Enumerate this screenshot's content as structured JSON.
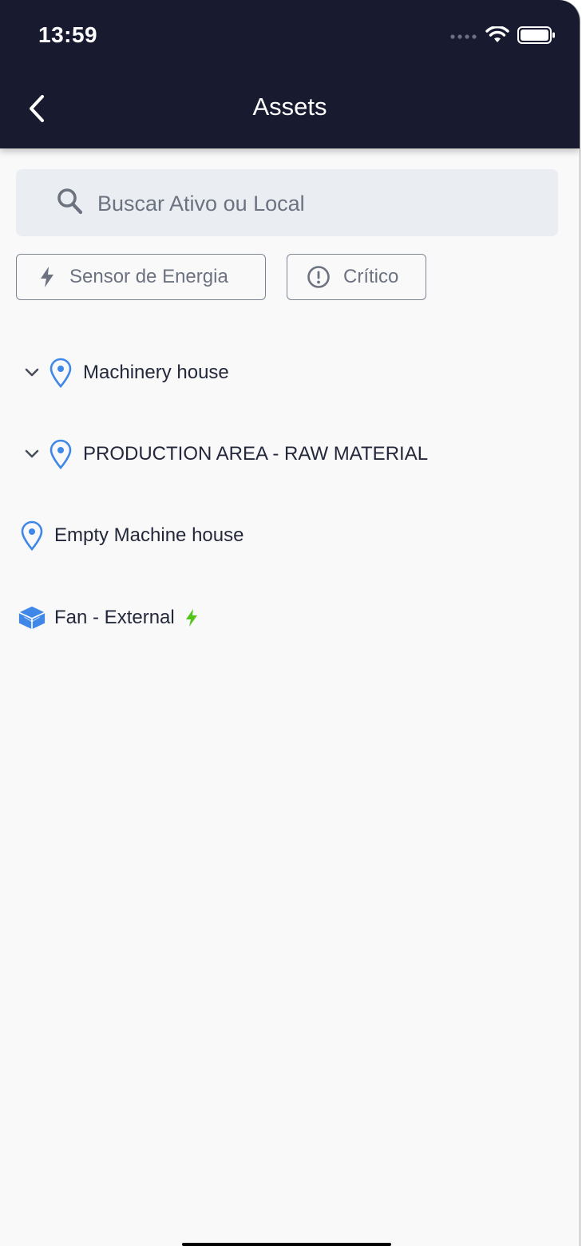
{
  "status_bar": {
    "time": "13:59"
  },
  "header": {
    "title": "Assets"
  },
  "search": {
    "placeholder": "Buscar Ativo ou Local",
    "value": ""
  },
  "filters": [
    {
      "label": "Sensor de Energia",
      "icon": "bolt-icon"
    },
    {
      "label": "Crítico",
      "icon": "alert-circle-icon"
    }
  ],
  "tree": [
    {
      "label": "Machinery house",
      "type": "location",
      "expandable": true
    },
    {
      "label": "PRODUCTION AREA - RAW MATERIAL",
      "type": "location",
      "expandable": true
    },
    {
      "label": "Empty Machine house",
      "type": "location",
      "expandable": false
    },
    {
      "label": "Fan - External",
      "type": "component",
      "expandable": false,
      "sensor": "energy"
    }
  ],
  "colors": {
    "header_bg": "#181b30",
    "accent_blue": "#3f88e8",
    "energy_green": "#52c41a",
    "muted_text": "#6c7280"
  }
}
